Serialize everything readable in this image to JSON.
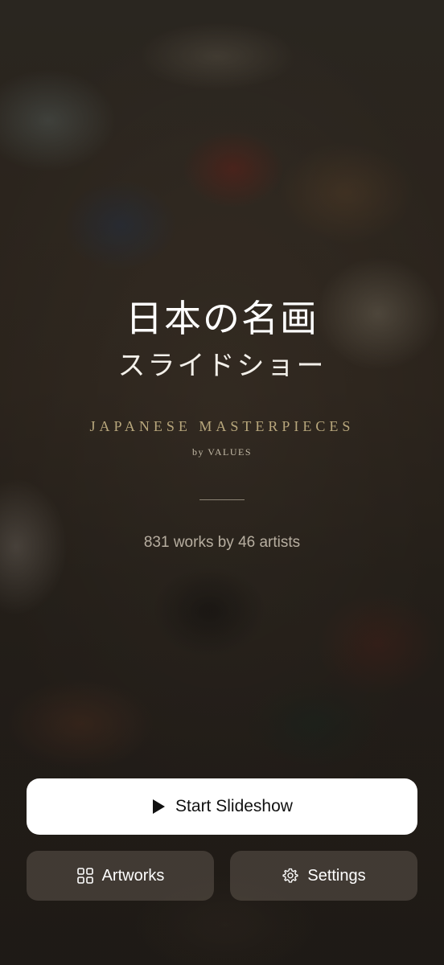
{
  "hero": {
    "title_jp": "日本の名画",
    "subtitle_jp": "スライドショー",
    "title_en": "JAPANESE MASTERPIECES",
    "byline": "by VALUES",
    "stats": "831 works by 46 artists"
  },
  "actions": {
    "start": {
      "label": "Start Slideshow",
      "icon": "play-icon"
    },
    "artworks": {
      "label": "Artworks",
      "icon": "grid-icon"
    },
    "settings": {
      "label": "Settings",
      "icon": "gear-icon"
    }
  },
  "colors": {
    "primary_button": "#ffffff",
    "english_title": "#b8a77c",
    "stats_text": "#b7aea0"
  }
}
